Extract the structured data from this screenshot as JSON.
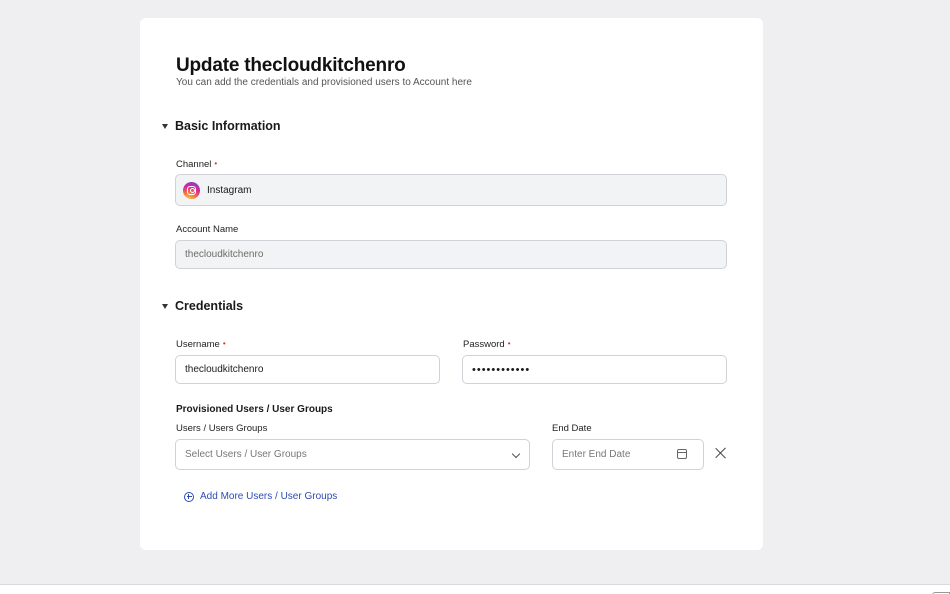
{
  "header": {
    "title": "Update thecloudkitchenro",
    "subtitle": "You can add the credentials and provisioned users to Account here"
  },
  "sections": {
    "basic": {
      "label": "Basic Information",
      "channel_label": "Channel",
      "channel_value": "Instagram",
      "channel_icon": "instagram-icon",
      "account_name_label": "Account Name",
      "account_name_value": "thecloudkitchenro"
    },
    "credentials": {
      "label": "Credentials",
      "username_label": "Username",
      "username_value": "thecloudkitchenro",
      "password_label": "Password",
      "password_value": "••••••••••••"
    }
  },
  "provisioned": {
    "heading": "Provisioned Users / User Groups",
    "users_label": "Users / Users Groups",
    "users_placeholder": "Select Users / User Groups",
    "end_date_label": "End Date",
    "end_date_placeholder": "Enter End Date",
    "add_more_label": "Add More Users / User Groups"
  },
  "required_marker": "•",
  "colors": {
    "accent": "#2e4bb5",
    "required": "#d0342c",
    "background": "#efeff1"
  }
}
